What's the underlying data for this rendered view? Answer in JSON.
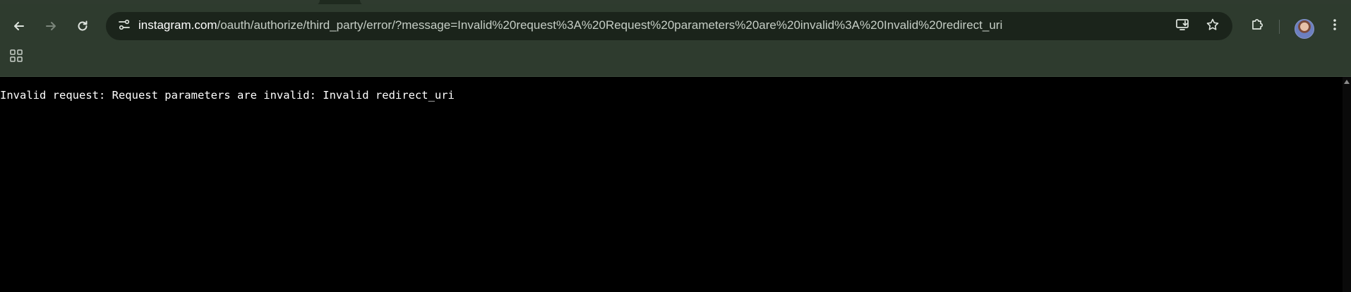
{
  "browser": {
    "url_host": "instagram.com",
    "url_path": "/oauth/authorize/third_party/error/?message=Invalid%20request%3A%20Request%20parameters%20are%20invalid%3A%20Invalid%20redirect_uri",
    "icons": {
      "back": "arrow-left-icon",
      "forward": "arrow-right-icon",
      "reload": "reload-icon",
      "site_info": "tune-icon",
      "install": "install-app-icon",
      "bookmark": "star-icon",
      "extensions": "puzzle-icon",
      "menu": "kebab-menu-icon",
      "apps": "apps-grid-icon"
    }
  },
  "page": {
    "message": "Invalid request: Request parameters are invalid: Invalid redirect_uri"
  },
  "colors": {
    "toolbar": "#2e3b2e",
    "omnibox": "#1b241b",
    "page_background": "#000000",
    "page_text": "#ffffff"
  }
}
